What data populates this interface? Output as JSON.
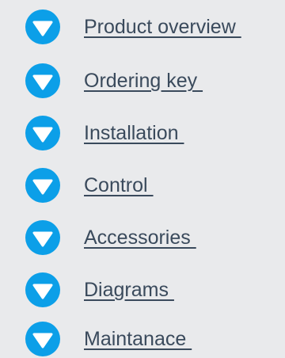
{
  "theme": {
    "background": "#e9eaec",
    "icon_color": "#0c9fe8",
    "text_color": "#3a4a5c"
  },
  "nav": {
    "items": [
      {
        "label": "Product overview ",
        "icon": "chevron-down-circle-icon"
      },
      {
        "label": "Ordering key ",
        "icon": "chevron-down-circle-icon"
      },
      {
        "label": "Installation ",
        "icon": "chevron-down-circle-icon"
      },
      {
        "label": "Control ",
        "icon": "chevron-down-circle-icon"
      },
      {
        "label": "Accessories ",
        "icon": "chevron-down-circle-icon"
      },
      {
        "label": "Diagrams ",
        "icon": "chevron-down-circle-icon"
      },
      {
        "label": "Maintanace ",
        "icon": "chevron-down-circle-icon"
      }
    ]
  }
}
